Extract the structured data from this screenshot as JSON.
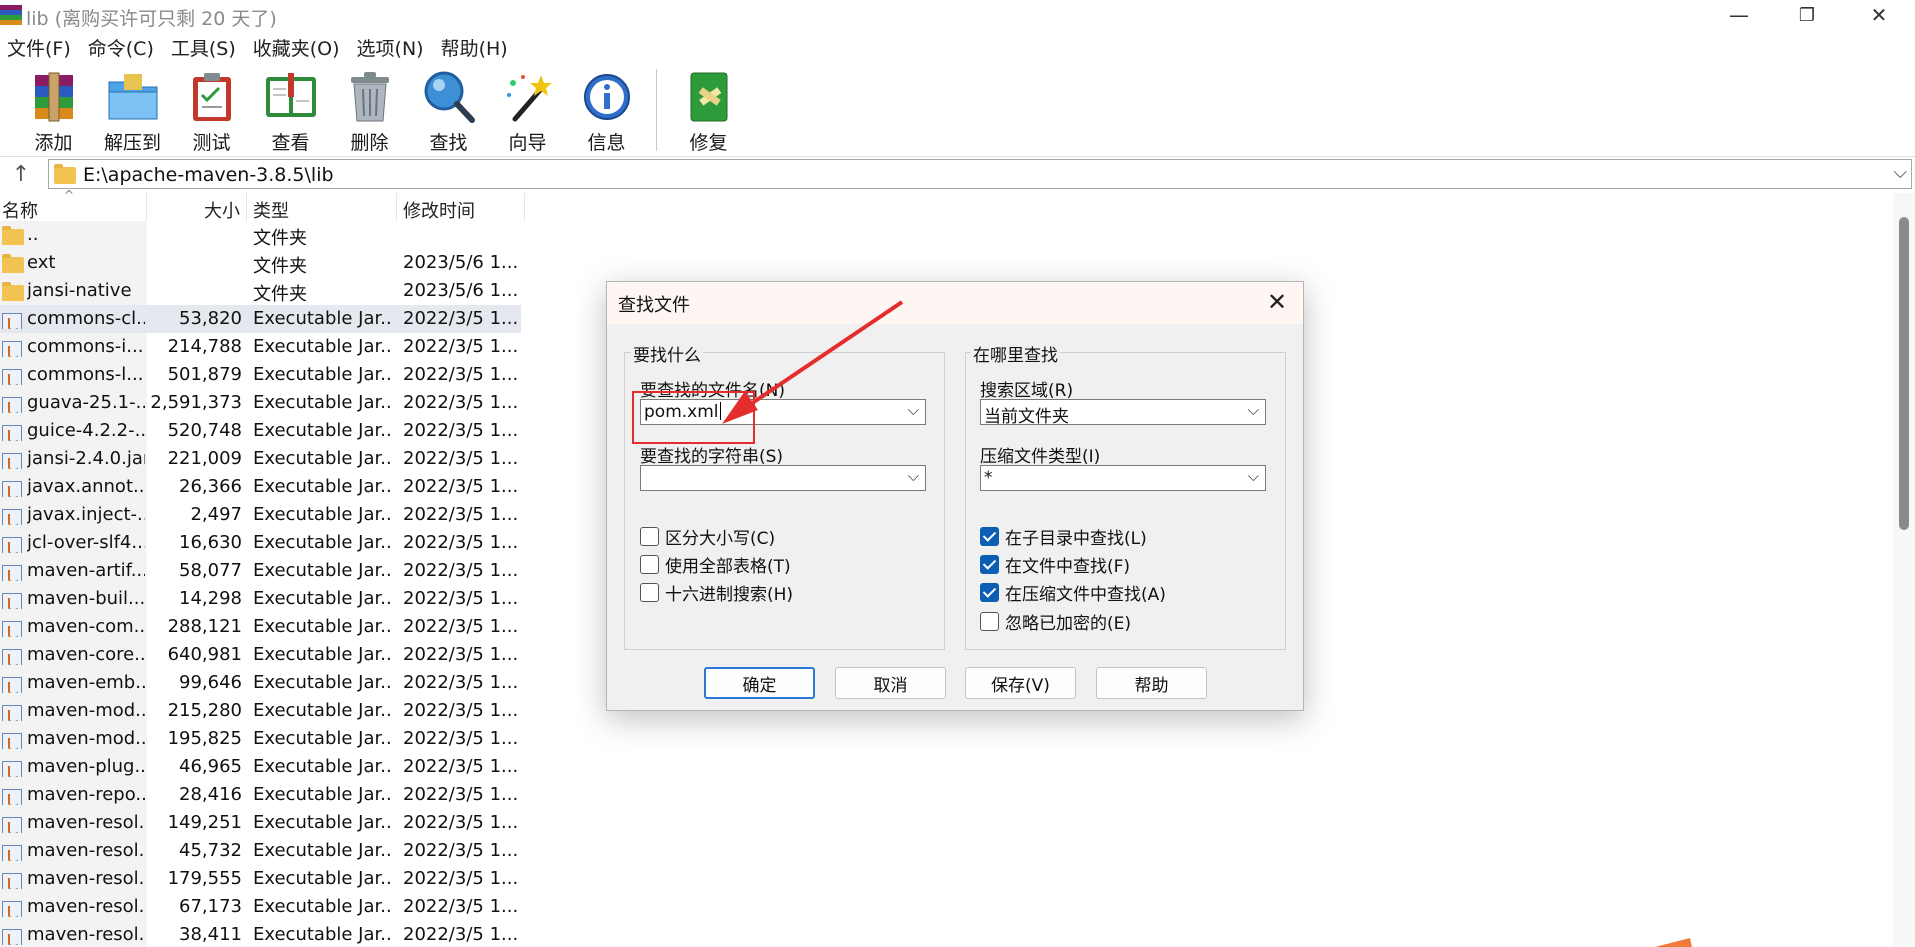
{
  "window": {
    "title": "lib (离购买许可只剩 20 天了)",
    "minimize": "—",
    "restore": "❐",
    "close": "✕"
  },
  "menu": [
    "文件(F)",
    "命令(C)",
    "工具(S)",
    "收藏夹(O)",
    "选项(N)",
    "帮助(H)"
  ],
  "toolbar": {
    "add": "添加",
    "extract": "解压到",
    "test": "测试",
    "view": "查看",
    "delete": "删除",
    "find": "查找",
    "wizard": "向导",
    "info": "信息",
    "repair": "修复"
  },
  "address": {
    "path": "E:\\apache-maven-3.8.5\\lib",
    "up": "↑",
    "dropdown": "⌵"
  },
  "columns": {
    "name": "名称",
    "size": "大小",
    "type": "类型",
    "modified": "修改时间",
    "sort": "^"
  },
  "files": [
    {
      "name": "..",
      "size": "",
      "type": "文件夹",
      "date": "",
      "icon": "folder-icon"
    },
    {
      "name": "ext",
      "size": "",
      "type": "文件夹",
      "date": "2023/5/6 1...",
      "icon": "folder-icon"
    },
    {
      "name": "jansi-native",
      "size": "",
      "type": "文件夹",
      "date": "2023/5/6 1...",
      "icon": "folder-icon"
    },
    {
      "name": "commons-cl...",
      "size": "53,820",
      "type": "Executable Jar...",
      "date": "2022/3/5 1...",
      "icon": "jar-icon"
    },
    {
      "name": "commons-i...",
      "size": "214,788",
      "type": "Executable Jar...",
      "date": "2022/3/5 1...",
      "icon": "jar-icon"
    },
    {
      "name": "commons-l...",
      "size": "501,879",
      "type": "Executable Jar...",
      "date": "2022/3/5 1...",
      "icon": "jar-icon"
    },
    {
      "name": "guava-25.1-...",
      "size": "2,591,373",
      "type": "Executable Jar...",
      "date": "2022/3/5 1...",
      "icon": "jar-icon"
    },
    {
      "name": "guice-4.2.2-...",
      "size": "520,748",
      "type": "Executable Jar...",
      "date": "2022/3/5 1...",
      "icon": "jar-icon"
    },
    {
      "name": "jansi-2.4.0.jar",
      "size": "221,009",
      "type": "Executable Jar...",
      "date": "2022/3/5 1...",
      "icon": "jar-icon"
    },
    {
      "name": "javax.annot...",
      "size": "26,366",
      "type": "Executable Jar...",
      "date": "2022/3/5 1...",
      "icon": "jar-icon"
    },
    {
      "name": "javax.inject-...",
      "size": "2,497",
      "type": "Executable Jar...",
      "date": "2022/3/5 1...",
      "icon": "jar-icon"
    },
    {
      "name": "jcl-over-slf4...",
      "size": "16,630",
      "type": "Executable Jar...",
      "date": "2022/3/5 1...",
      "icon": "jar-icon"
    },
    {
      "name": "maven-artif...",
      "size": "58,077",
      "type": "Executable Jar...",
      "date": "2022/3/5 1...",
      "icon": "jar-icon"
    },
    {
      "name": "maven-buil...",
      "size": "14,298",
      "type": "Executable Jar...",
      "date": "2022/3/5 1...",
      "icon": "jar-icon"
    },
    {
      "name": "maven-com...",
      "size": "288,121",
      "type": "Executable Jar...",
      "date": "2022/3/5 1...",
      "icon": "jar-icon"
    },
    {
      "name": "maven-core...",
      "size": "640,981",
      "type": "Executable Jar...",
      "date": "2022/3/5 1...",
      "icon": "jar-icon"
    },
    {
      "name": "maven-emb...",
      "size": "99,646",
      "type": "Executable Jar...",
      "date": "2022/3/5 1...",
      "icon": "jar-icon"
    },
    {
      "name": "maven-mod...",
      "size": "215,280",
      "type": "Executable Jar...",
      "date": "2022/3/5 1...",
      "icon": "jar-icon"
    },
    {
      "name": "maven-mod...",
      "size": "195,825",
      "type": "Executable Jar...",
      "date": "2022/3/5 1...",
      "icon": "jar-icon"
    },
    {
      "name": "maven-plug...",
      "size": "46,965",
      "type": "Executable Jar...",
      "date": "2022/3/5 1...",
      "icon": "jar-icon"
    },
    {
      "name": "maven-repo...",
      "size": "28,416",
      "type": "Executable Jar...",
      "date": "2022/3/5 1...",
      "icon": "jar-icon"
    },
    {
      "name": "maven-resol...",
      "size": "149,251",
      "type": "Executable Jar...",
      "date": "2022/3/5 1...",
      "icon": "jar-icon"
    },
    {
      "name": "maven-resol...",
      "size": "45,732",
      "type": "Executable Jar...",
      "date": "2022/3/5 1...",
      "icon": "jar-icon"
    },
    {
      "name": "maven-resol...",
      "size": "179,555",
      "type": "Executable Jar...",
      "date": "2022/3/5 1...",
      "icon": "jar-icon"
    },
    {
      "name": "maven-resol...",
      "size": "67,173",
      "type": "Executable Jar...",
      "date": "2022/3/5 1...",
      "icon": "jar-icon"
    },
    {
      "name": "maven-resol...",
      "size": "38,411",
      "type": "Executable Jar...",
      "date": "2022/3/5 1...",
      "icon": "jar-icon"
    }
  ],
  "selected_row": 3,
  "dialog": {
    "title": "查找文件",
    "close": "✕",
    "what_group": "要找什么",
    "filename_label": "要查找的文件名(N)",
    "filename_value": "pom.xml",
    "string_label": "要查找的字符串(S)",
    "string_value": "",
    "options": [
      {
        "label": "区分大小写(C)",
        "checked": false
      },
      {
        "label": "使用全部表格(T)",
        "checked": false
      },
      {
        "label": "十六进制搜索(H)",
        "checked": false
      }
    ],
    "where_group": "在哪里查找",
    "area_label": "搜索区域(R)",
    "area_value": "当前文件夹",
    "archive_type_label": "压缩文件类型(I)",
    "archive_type_value": "*",
    "where_options": [
      {
        "label": "在子目录中查找(L)",
        "checked": true
      },
      {
        "label": "在文件中查找(F)",
        "checked": true
      },
      {
        "label": "在压缩文件中查找(A)",
        "checked": true
      },
      {
        "label": "忽略已加密的(E)",
        "checked": false
      }
    ],
    "buttons": {
      "ok": "确定",
      "cancel": "取消",
      "save": "保存(V)",
      "help": "帮助"
    },
    "dropdown_glyph": "⌵"
  },
  "colors": {
    "annotation_red": "#e52d2d",
    "checkbox_blue": "#0a5fb4",
    "selected_row": "#e5e9ef"
  }
}
